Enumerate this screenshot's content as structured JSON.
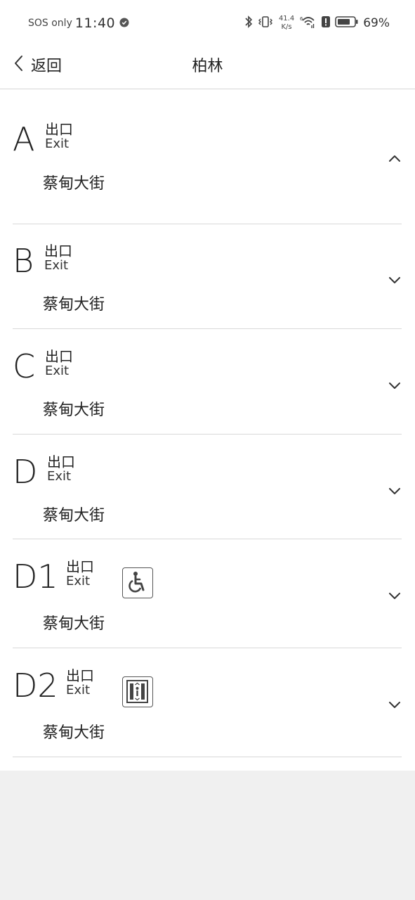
{
  "status_bar": {
    "carrier": "SOS only",
    "time": "11:40",
    "speed_value": "41.4",
    "speed_unit": "K/s",
    "battery": "69%"
  },
  "header": {
    "back_label": "返回",
    "title": "柏林"
  },
  "exits": [
    {
      "letter": "A",
      "cn": "出口",
      "en": "Exit",
      "street": "蔡甸大街",
      "expanded": true,
      "facility": ""
    },
    {
      "letter": "B",
      "cn": "出口",
      "en": "Exit",
      "street": "蔡甸大街",
      "expanded": false,
      "facility": ""
    },
    {
      "letter": "C",
      "cn": "出口",
      "en": "Exit",
      "street": "蔡甸大街",
      "expanded": false,
      "facility": ""
    },
    {
      "letter": "D",
      "cn": "出口",
      "en": "Exit",
      "street": "蔡甸大街",
      "expanded": false,
      "facility": ""
    },
    {
      "letter": "D1",
      "cn": "出口",
      "en": "Exit",
      "street": "蔡甸大街",
      "expanded": false,
      "facility": "wheelchair-icon"
    },
    {
      "letter": "D2",
      "cn": "出口",
      "en": "Exit",
      "street": "蔡甸大街",
      "expanded": false,
      "facility": "elevator-icon"
    }
  ]
}
